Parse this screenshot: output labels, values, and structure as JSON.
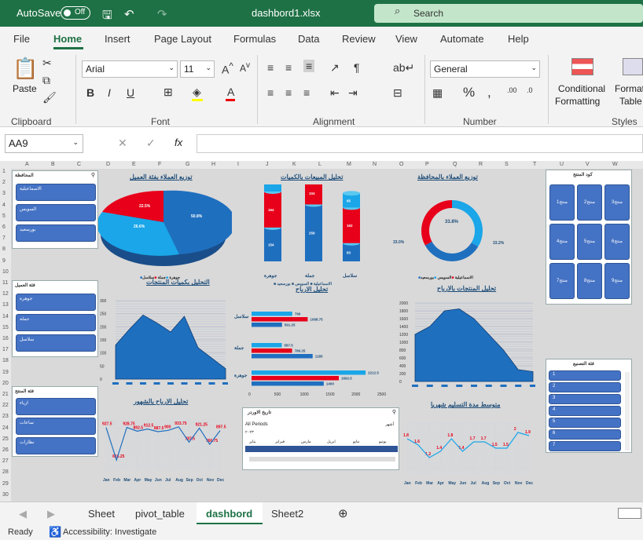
{
  "titlebar": {
    "autosave": "AutoSave",
    "toggle": "Off",
    "filename": "dashbord1.xlsx",
    "search": "Search"
  },
  "menu": [
    "File",
    "Home",
    "Insert",
    "Page Layout",
    "Formulas",
    "Data",
    "Review",
    "View",
    "Automate",
    "Help"
  ],
  "ribbon": {
    "paste": "Paste",
    "font_name": "Arial",
    "font_size": "11",
    "number_format": "General",
    "conditional1": "Conditional",
    "conditional2": "Formatting",
    "format1": "Format",
    "format2": "Table",
    "groups": [
      "Clipboard",
      "Font",
      "Alignment",
      "Number",
      "Styles"
    ],
    "bold": "B",
    "italic": "I",
    "underline": "U",
    "fx": "fx",
    "percent": "%"
  },
  "namebox": "AA9",
  "columns": [
    "A",
    "B",
    "C",
    "D",
    "E",
    "F",
    "G",
    "H",
    "I",
    "J",
    "K",
    "L",
    "M",
    "N",
    "O",
    "P",
    "Q",
    "R",
    "S",
    "T",
    "U",
    "V",
    "W"
  ],
  "rows": [
    "1",
    "2",
    "3",
    "4",
    "5",
    "6",
    "7",
    "8",
    "9",
    "10",
    "11",
    "12",
    "13",
    "14",
    "15",
    "16",
    "17",
    "18",
    "19",
    "20",
    "21",
    "22",
    "23",
    "24",
    "25",
    "26",
    "27",
    "28",
    "29",
    "30"
  ],
  "slicers": {
    "gov": {
      "title": "المحافظة",
      "items": [
        "الاسماعيلية",
        "السويس",
        "بورسعيد"
      ]
    },
    "cust": {
      "title": "فئة العميل",
      "items": [
        "جوهرة",
        "جملة",
        "سلاسل"
      ]
    },
    "prod": {
      "title": "فئة المنتج",
      "items": [
        "ازياء",
        "ساعات",
        "نظارات"
      ]
    },
    "code": {
      "title": "كود المنتج",
      "items": [
        "منتج1",
        "منتج2",
        "منتج3",
        "منتج4",
        "منتج5",
        "منتج6",
        "منتج7",
        "منتج8",
        "منتج9"
      ]
    },
    "cat": {
      "title": "فئة التصنيع",
      "items": [
        "1",
        "2",
        "3",
        "4",
        "5",
        "6",
        "7"
      ]
    }
  },
  "charts": {
    "pie_title": "توزيع العملاء بفئة العميل",
    "pie_labels": [
      "50.8%",
      "26.6%",
      "22.5%"
    ],
    "pie_legend": [
      "جوهرة",
      "جملة",
      "سلاسل"
    ],
    "cyl_title": "تحليل المبيعات بالكميات",
    "cyl_cats": [
      "جوهرة",
      "جملة",
      "سلاسل"
    ],
    "cyl_legend": [
      "الاسماعيلية",
      "السويس",
      "بورسعيد"
    ],
    "donut_title": "توزيع العملاء بالمحافظة",
    "donut_labels": [
      "33.8%",
      "33.0%",
      "33.2%"
    ],
    "area1_title": "التحليل بكميات المنتجات",
    "bar_title": "تحليل الارباح",
    "area2_title": "تحليل المنتجات بالارباح",
    "line1_title": "تحليل الارباح بالشهور",
    "timeline_title": "تاريخ الاوردر",
    "timeline_periods": "All Periods",
    "timeline_year": "٢٠٢٣",
    "timeline_unit": "أشهر",
    "timeline_months": [
      "يناير",
      "فبراير",
      "مارس",
      "ابريل",
      "مايو",
      "يونيو"
    ],
    "line2_title": "متوسط مدة التسليم شهريا",
    "months": [
      "Jan",
      "Feb",
      "Mar",
      "Apr",
      "May",
      "Jun",
      "Jul",
      "Aug",
      "Sep",
      "Oct",
      "Nov",
      "Dec"
    ]
  },
  "chart_data": [
    {
      "type": "pie",
      "title": "توزيع العملاء بفئة العميل",
      "categories": [
        "جوهرة",
        "جملة",
        "سلاسل"
      ],
      "values": [
        50.8,
        26.6,
        22.5
      ]
    },
    {
      "type": "bar",
      "title": "تحليل المبيعات بالكميات",
      "categories": [
        "جوهرة",
        "جملة",
        "سلاسل"
      ],
      "series": [
        {
          "name": "الاسماعيلية",
          "values": [
            154,
            259,
            83
          ]
        },
        {
          "name": "السويس",
          "values": [
            164,
            104,
            162
          ]
        },
        {
          "name": "بورسعيد",
          "values": [
            247,
            86,
            65
          ]
        }
      ]
    },
    {
      "type": "pie",
      "title": "توزيع العملاء بالمحافظة",
      "categories": [
        "بورسعيد",
        "السويس",
        "الاسماعيلية"
      ],
      "values": [
        33.8,
        33.0,
        33.2
      ]
    },
    {
      "type": "area",
      "title": "التحليل بكميات المنتجات",
      "ylim": [
        0,
        300
      ],
      "values": [
        130,
        190,
        245,
        215,
        180,
        240,
        120,
        80,
        40
      ]
    },
    {
      "type": "bar",
      "title": "تحليل الارباح",
      "categories": [
        "سلاسل",
        "جملة",
        "جوهرة"
      ],
      "xlim": [
        0,
        2500
      ],
      "series": [
        {
          "values": [
            790,
            587.5,
            2212.5
          ]
        },
        {
          "values": [
            1088.75,
            786.25,
            1692.5
          ]
        },
        {
          "values": [
            591.25,
            1185,
            1400
          ]
        }
      ]
    },
    {
      "type": "area",
      "title": "تحليل المنتجات بالارباح",
      "ylim": [
        0,
        2000
      ],
      "values": [
        1200,
        1400,
        1800,
        1850,
        1600,
        1200,
        800,
        300,
        250
      ]
    },
    {
      "type": "line",
      "title": "تحليل الارباح بالشهور",
      "categories": [
        "Jan",
        "Feb",
        "Mar",
        "Apr",
        "May",
        "Jun",
        "Jul",
        "Aug",
        "Sep",
        "Oct",
        "Nov",
        "Dec"
      ],
      "values": [
        927.5,
        616.25,
        928.75,
        892.5,
        912.5,
        887.5,
        900,
        933.75,
        787.5,
        921.25,
        766.75,
        897.5
      ]
    },
    {
      "type": "line",
      "title": "متوسط مدة التسليم شهريا",
      "categories": [
        "Jan",
        "Feb",
        "Mar",
        "Apr",
        "May",
        "Jun",
        "Jul",
        "Aug",
        "Sep",
        "Oct",
        "Nov",
        "Dec"
      ],
      "values": [
        1.8,
        1.6,
        1.2,
        1.4,
        1.8,
        1.4,
        1.7,
        1.7,
        1.5,
        1.5,
        2.0,
        1.9
      ]
    }
  ],
  "tabs": [
    "Sheet",
    "pivot_table",
    "dashbord",
    "Sheet2"
  ],
  "status": {
    "ready": "Ready",
    "accessibility": "Accessibility: Investigate"
  }
}
